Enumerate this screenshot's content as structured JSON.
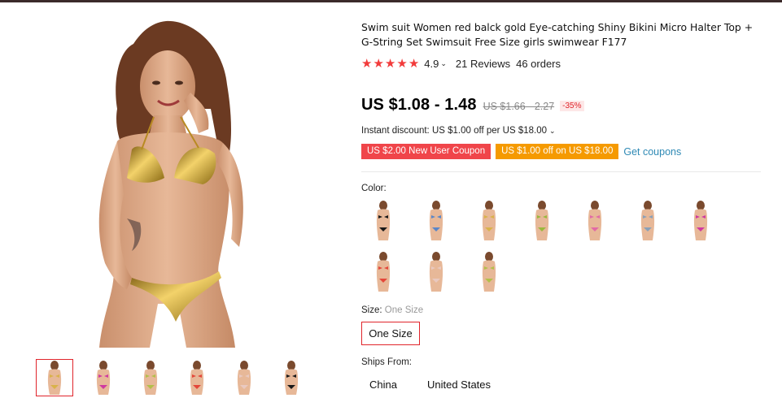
{
  "product": {
    "title": "Swim suit Women red balck gold Eye-catching Shiny Bikini Micro Halter Top + G-String Set Swimsuit Free Size girls swimwear F177",
    "rating": "4.9",
    "stars": 5,
    "reviews": "21 Reviews",
    "orders": "46 orders",
    "price": "US $1.08 - 1.48",
    "old_price": "US $1.66 - 2.27",
    "discount": "-35%",
    "instant_discount": "Instant discount: US $1.00 off per US $18.00",
    "coupons": [
      {
        "label": "US $2.00 New User Coupon",
        "color": "#f0454a"
      },
      {
        "label": "US $1.00 off on US $18.00",
        "color": "#f59a00"
      }
    ],
    "get_coupons": "Get coupons",
    "color_label": "Color:",
    "swatch_colors": [
      "#1a1a1a",
      "#5b86c7",
      "#d9b24a",
      "#9ab83d",
      "#e26aa6",
      "#8aa0b8",
      "#d03aa0",
      "#e4473a",
      "#e9c9c0",
      "#b3bf4a"
    ],
    "size_label": "Size:",
    "size_value": "One Size",
    "size_option": "One Size",
    "ships_label": "Ships From:",
    "ships_options": [
      "China",
      "United States"
    ]
  },
  "gallery": {
    "thumb_colors": [
      "#d9b24a",
      "#d03aa0",
      "#b3bf4a",
      "#e4473a",
      "#e9c9c0",
      "#1a1a1a"
    ],
    "selected_index": 0
  }
}
